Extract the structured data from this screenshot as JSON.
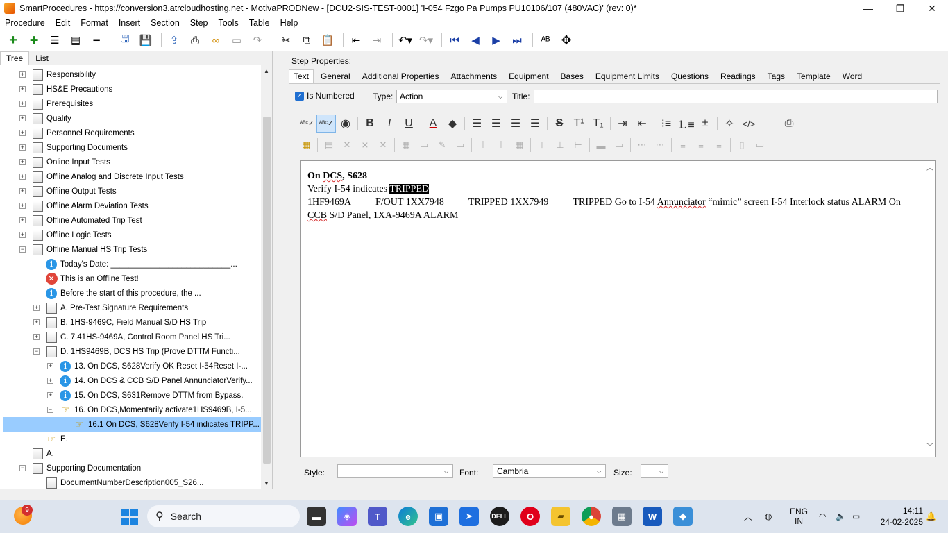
{
  "window": {
    "title": "SmartProcedures - https://conversion3.atrcloudhosting.net - MotivaPRODNew - [DCU2-SIS-TEST-0001] 'I-054 Fzgo Pa Pumps PU10106/107 (480VAC)' (rev: 0)*",
    "minimize": "—",
    "restore": "❐",
    "close": "✕"
  },
  "menu": [
    "Procedure",
    "Edit",
    "Format",
    "Insert",
    "Section",
    "Step",
    "Tools",
    "Table",
    "Help"
  ],
  "left_tabs": [
    "Tree",
    "List"
  ],
  "tree": [
    {
      "label": "Responsibility",
      "icon": "page",
      "depth": 0,
      "exp": "+"
    },
    {
      "label": "HS&E Precautions",
      "icon": "page",
      "depth": 0,
      "exp": "+"
    },
    {
      "label": "Prerequisites",
      "icon": "page",
      "depth": 0,
      "exp": "+"
    },
    {
      "label": "Quality",
      "icon": "page",
      "depth": 0,
      "exp": "+"
    },
    {
      "label": "Personnel Requirements",
      "icon": "page",
      "depth": 0,
      "exp": "+"
    },
    {
      "label": "Supporting Documents",
      "icon": "page",
      "depth": 0,
      "exp": "+"
    },
    {
      "label": "Online Input Tests",
      "icon": "page",
      "depth": 0,
      "exp": "+"
    },
    {
      "label": "Offline Analog and Discrete Input Tests",
      "icon": "page",
      "depth": 0,
      "exp": "+"
    },
    {
      "label": "Offline Output Tests",
      "icon": "page",
      "depth": 0,
      "exp": "+"
    },
    {
      "label": "Offline Alarm Deviation Tests",
      "icon": "page",
      "depth": 0,
      "exp": "+"
    },
    {
      "label": "Offline Automated Trip Test",
      "icon": "page",
      "depth": 0,
      "exp": "+"
    },
    {
      "label": "Offline Logic Tests",
      "icon": "page",
      "depth": 0,
      "exp": "+"
    },
    {
      "label": "Offline Manual HS Trip Tests",
      "icon": "page",
      "depth": 0,
      "exp": "−"
    },
    {
      "label": "Today's Date: ___________________________...",
      "icon": "info",
      "depth": 1,
      "exp": ""
    },
    {
      "label": "This is an Offline Test!",
      "icon": "error",
      "depth": 1,
      "exp": ""
    },
    {
      "label": "Before the start of this procedure, the ...",
      "icon": "info",
      "depth": 1,
      "exp": ""
    },
    {
      "label": "A. Pre-Test Signature Requirements",
      "icon": "page",
      "depth": 1,
      "exp": "+"
    },
    {
      "label": "B. 1HS-9469C, Field Manual S/D HS Trip",
      "icon": "page",
      "depth": 1,
      "exp": "+"
    },
    {
      "label": "C. 7.41HS-9469A, Control Room Panel HS Tri...",
      "icon": "page",
      "depth": 1,
      "exp": "+"
    },
    {
      "label": "D. 1HS9469B, DCS HS Trip (Prove DTTM Functi...",
      "icon": "page",
      "depth": 1,
      "exp": "−"
    },
    {
      "label": "13. On DCS, S628Verify OK Reset I-54Reset I-...",
      "icon": "info",
      "depth": 2,
      "exp": "+"
    },
    {
      "label": "14. On DCS & CCB S/D Panel AnnunciatorVerify...",
      "icon": "info",
      "depth": 2,
      "exp": "+"
    },
    {
      "label": "15. On DCS, S631Remove DTTM from Bypass.",
      "icon": "info",
      "depth": 2,
      "exp": "+"
    },
    {
      "label": "16. On DCS,Momentarily activate1HS9469B, I-5...",
      "icon": "hand",
      "depth": 2,
      "exp": "−"
    },
    {
      "label": "16.1  On DCS, S628Verify I-54 indicates TRIPP...",
      "icon": "hand",
      "depth": 3,
      "exp": "",
      "selected": true
    },
    {
      "label": "E.",
      "icon": "hand",
      "depth": 1,
      "exp": ""
    },
    {
      "label": "A.",
      "icon": "page",
      "depth": 0,
      "exp": ""
    },
    {
      "label": "Supporting Documentation",
      "icon": "page",
      "depth": 0,
      "exp": "−"
    },
    {
      "label": "DocumentNumberDescription005_S26...",
      "icon": "doc",
      "depth": 1,
      "exp": ""
    }
  ],
  "step_properties_label": "Step Properties:",
  "right_tabs": [
    "Text",
    "General",
    "Additional Properties",
    "Attachments",
    "Equipment",
    "Bases",
    "Equipment Limits",
    "Questions",
    "Readings",
    "Tags",
    "Template",
    "Word"
  ],
  "is_numbered_label": "Is Numbered",
  "type_label": "Type:",
  "type_value": "Action",
  "title_label": "Title:",
  "title_value": "",
  "editor": {
    "line1": "On DCS, S628",
    "line2_prefix": "Verify I-54 indicates ",
    "line2_highlight": "TRIPPED",
    "para": "1HF9469A          F/OUT 1XX7948          TRIPPED 1XX7949          TRIPPED Go to I-54 Annunciator “mimic” screen I-54 Interlock status ALARM On CCB S/D Panel, 1XA-9469A ALARM"
  },
  "bottom": {
    "style_label": "Style:",
    "style_value": "",
    "font_label": "Font:",
    "font_value": "Cambria",
    "size_label": "Size:",
    "size_value": ""
  },
  "taskbar": {
    "weather_badge": "9",
    "search_placeholder": "Search",
    "lang_line1": "ENG",
    "lang_line2": "IN",
    "time": "14:11",
    "date": "24-02-2025"
  }
}
